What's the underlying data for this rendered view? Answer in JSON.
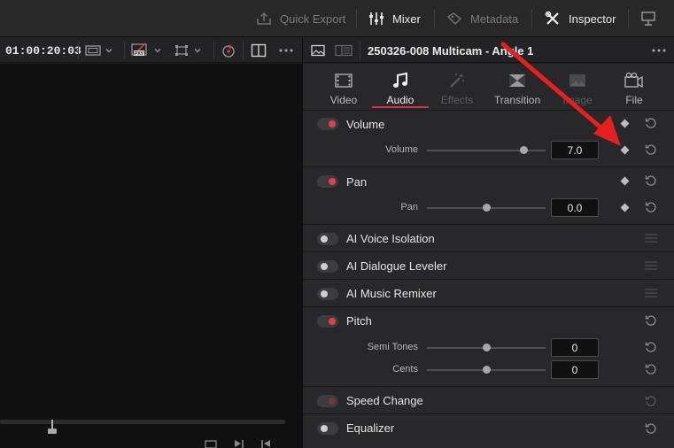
{
  "toolbar": {
    "quick_export": "Quick Export",
    "mixer": "Mixer",
    "metadata": "Metadata",
    "inspector": "Inspector"
  },
  "viewer": {
    "timecode": "01:00:20:03"
  },
  "inspector": {
    "clip_title": "250326-008 Multicam - Angle 1",
    "tabs": [
      {
        "label": "Video",
        "icon": "film-icon",
        "state": "normal"
      },
      {
        "label": "Audio",
        "icon": "music-note-icon",
        "state": "active"
      },
      {
        "label": "Effects",
        "icon": "magic-wand-icon",
        "state": "disabled"
      },
      {
        "label": "Transition",
        "icon": "transition-icon",
        "state": "normal"
      },
      {
        "label": "Image",
        "icon": "image-icon",
        "state": "disabled"
      },
      {
        "label": "File",
        "icon": "camera-file-icon",
        "state": "normal"
      }
    ],
    "sections": {
      "volume": {
        "label": "Volume",
        "enabled": true,
        "param_label": "Volume",
        "value": "7.0",
        "slider_fraction": 0.82
      },
      "pan": {
        "label": "Pan",
        "enabled": true,
        "param_label": "Pan",
        "value": "0.0",
        "slider_fraction": 0.5
      },
      "ai_voice": {
        "label": "AI Voice Isolation",
        "enabled": false
      },
      "ai_dialogue": {
        "label": "AI Dialogue Leveler",
        "enabled": false
      },
      "ai_music": {
        "label": "AI Music Remixer",
        "enabled": false
      },
      "pitch": {
        "label": "Pitch",
        "enabled": true,
        "semi_label": "Semi Tones",
        "semi_value": "0",
        "semi_fraction": 0.5,
        "cents_label": "Cents",
        "cents_value": "0",
        "cents_fraction": 0.5
      },
      "speed": {
        "label": "Speed Change",
        "enabled": false
      },
      "eq": {
        "label": "Equalizer",
        "enabled": false
      }
    }
  },
  "colors": {
    "accent_red": "#e2404a",
    "annotation_arrow": "#e5201e"
  }
}
